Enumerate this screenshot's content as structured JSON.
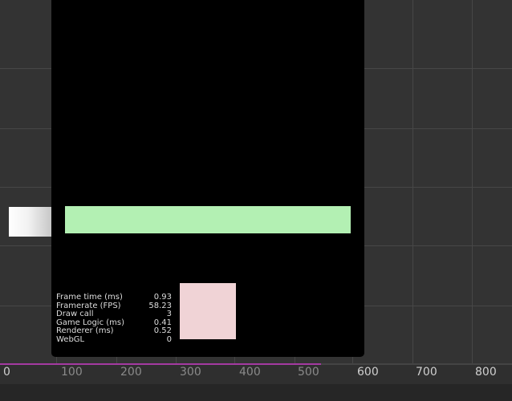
{
  "ruler": {
    "ticks": [
      {
        "label": "0",
        "dim": false
      },
      {
        "label": "100",
        "dim": true
      },
      {
        "label": "200",
        "dim": true
      },
      {
        "label": "300",
        "dim": true
      },
      {
        "label": "400",
        "dim": true
      },
      {
        "label": "500",
        "dim": true
      },
      {
        "label": "600",
        "dim": false
      },
      {
        "label": "700",
        "dim": false
      },
      {
        "label": "800",
        "dim": false
      }
    ]
  },
  "stats": [
    {
      "label": "Frame time (ms)",
      "value": "0.93"
    },
    {
      "label": "Framerate (FPS)",
      "value": "58.23"
    },
    {
      "label": "Draw call",
      "value": "3"
    },
    {
      "label": "Game Logic (ms)",
      "value": "0.41"
    },
    {
      "label": "Renderer (ms)",
      "value": "0.52"
    },
    {
      "label": "WebGL",
      "value": "0"
    }
  ],
  "colors": {
    "scene_background": "#333333",
    "canvas_background": "#000000",
    "green_bar": "#b3f0b3",
    "pink_box": "#f0d3d6",
    "ruler_axis": "#a43aa1"
  }
}
